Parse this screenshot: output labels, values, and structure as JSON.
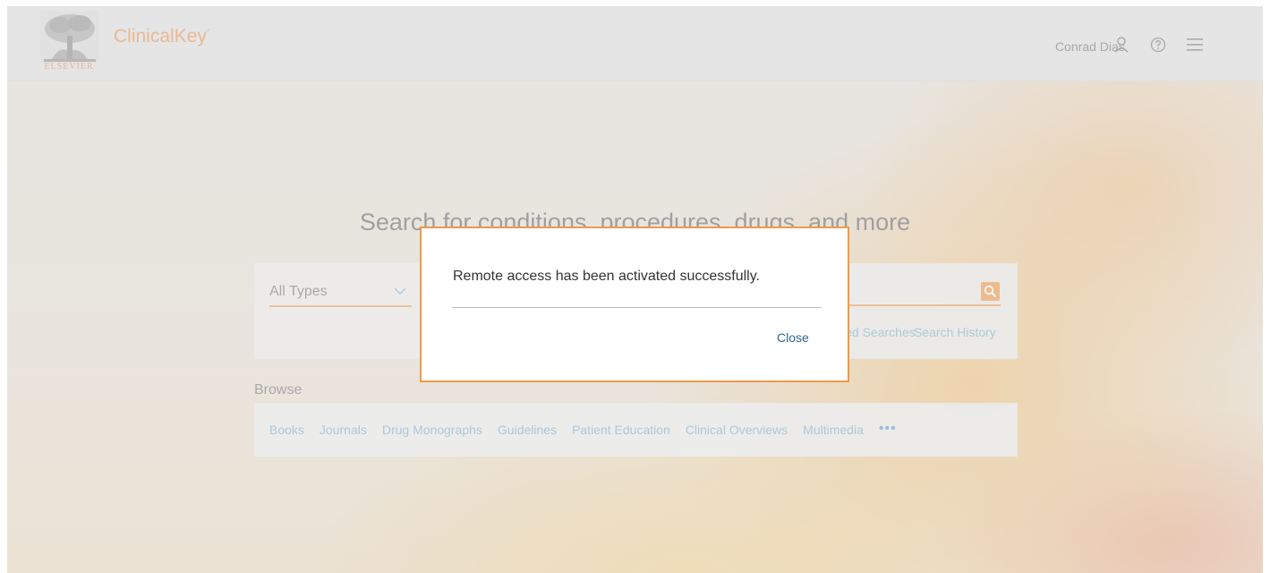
{
  "header": {
    "publisher": "ELSEVIER",
    "brand_name": "ClinicalKey",
    "brand_mark": "°",
    "user_name": "Conrad Dias",
    "icons": [
      "user-icon",
      "help-icon",
      "menu-icon"
    ]
  },
  "search": {
    "headline": "Search for conditions, procedures, drugs, and more",
    "type_selected": "All Types",
    "saved_searches_label": "Saved Searches",
    "search_history_label": "Search History"
  },
  "browse": {
    "label": "Browse",
    "links": [
      "Books",
      "Journals",
      "Drug Monographs",
      "Guidelines",
      "Patient Education",
      "Clinical Overviews",
      "Multimedia"
    ],
    "more": "•••"
  },
  "modal": {
    "message": "Remote access has been activated successfully.",
    "close_label": "Close"
  },
  "colors": {
    "brand_orange": "#f0a36a",
    "accent_orange": "#ee9a4c",
    "link_blue": "#8fbcd6",
    "close_blue": "#2d6693"
  }
}
